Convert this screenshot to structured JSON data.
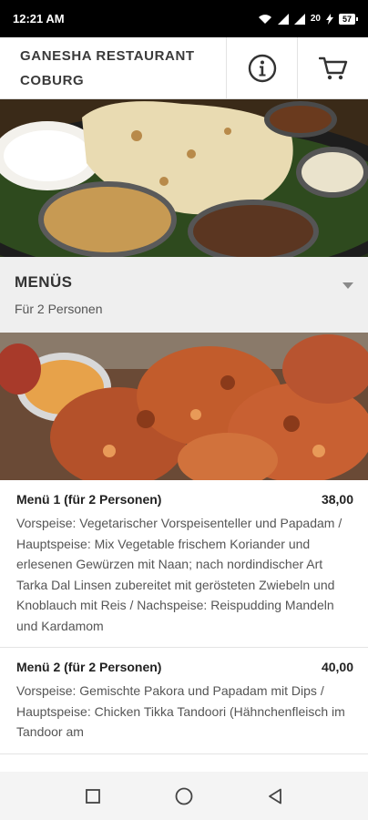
{
  "status": {
    "time": "12:21 AM",
    "data_rate": "20",
    "battery": "57"
  },
  "header": {
    "title_line1": "GANESHA RESTAURANT",
    "title_line2": "COBURG"
  },
  "menu": {
    "title": "MENÜS",
    "subtitle": "Für 2 Personen"
  },
  "items": [
    {
      "name": "Menü 1 (für 2 Personen)",
      "price": "38,00",
      "description": "Vorspeise: Vegetarischer Vorspeisenteller und Papadam / Hauptspeise: Mix Vegetable frischem Koriander und erlesenen Gewürzen mit Naan; nach nordindischer Art Tarka Dal Linsen zubereitet mit gerösteten Zwiebeln und Knoblauch mit Reis / Nachspeise: Reispudding Mandeln und Kardamom"
    },
    {
      "name": "Menü 2 (für 2 Personen)",
      "price": "40,00",
      "description": "Vorspeise: Gemischte Pakora und Papadam mit Dips / Hauptspeise: Chicken Tikka Tandoori (Hähnchenfleisch im Tandoor am"
    }
  ],
  "icons": {
    "info": "info-icon",
    "cart": "cart-icon",
    "dropdown": "caret-down-icon"
  },
  "colors": {
    "status_bar": "#000000",
    "header_bg": "#ffffff",
    "section_bg": "#efefef",
    "text_dark": "#333333"
  }
}
